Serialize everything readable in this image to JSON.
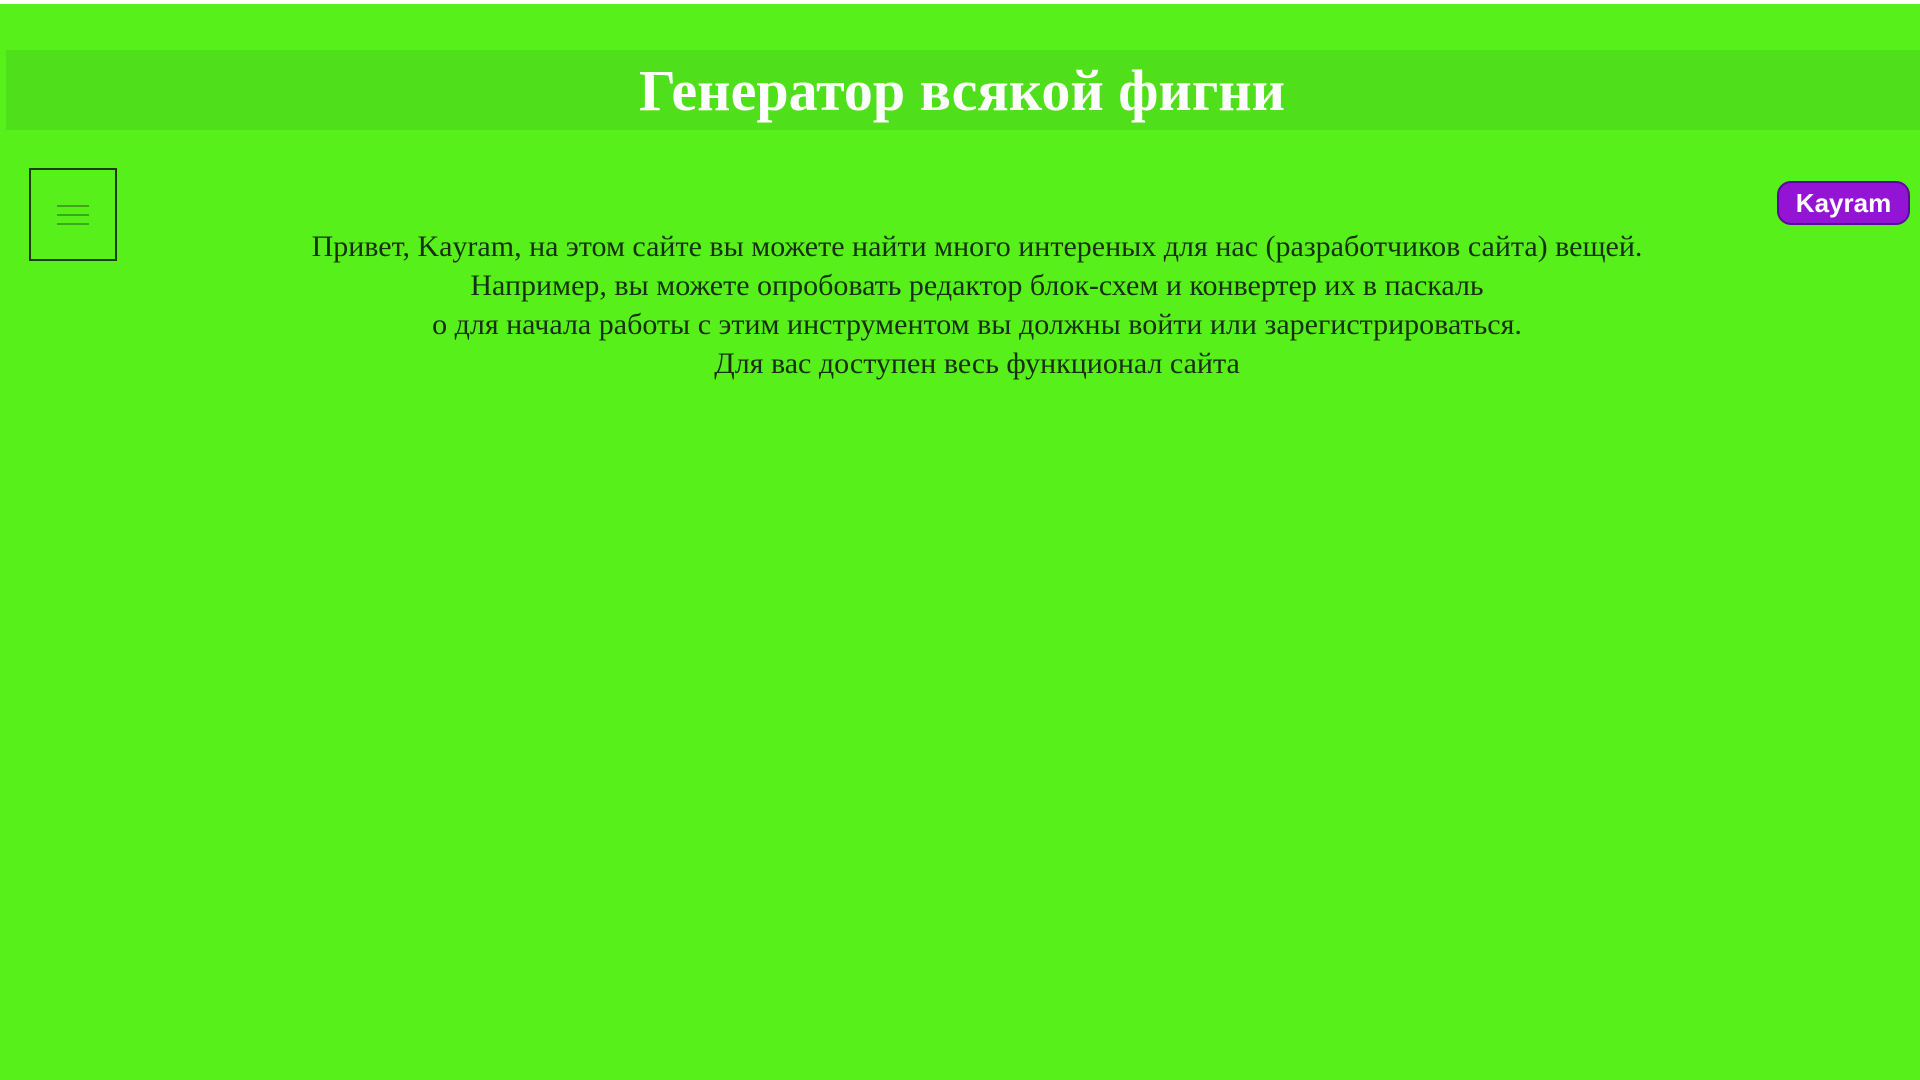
{
  "header": {
    "title": "Генератор всякой фигни"
  },
  "menu": {
    "icon": "hamburger-menu-icon"
  },
  "user": {
    "name": "Kayram"
  },
  "intro": {
    "lines": [
      "Привет, Kayram, на этом сайте вы можете найти много интереных для нас (разработчиков сайта) вещей.",
      "Например, вы можете опробовать редактор блок-схем и конвертер их в паскаль",
      "о для начала работы с этим инструментом вы должны войти или зарегистрироваться.",
      "Для вас доступен весь функционал сайта"
    ]
  },
  "colors": {
    "page_background": "#57f01a",
    "header_background": "#50df1b",
    "title_text": "#ffffff",
    "body_text": "#163010",
    "user_badge": "#9414d6"
  }
}
